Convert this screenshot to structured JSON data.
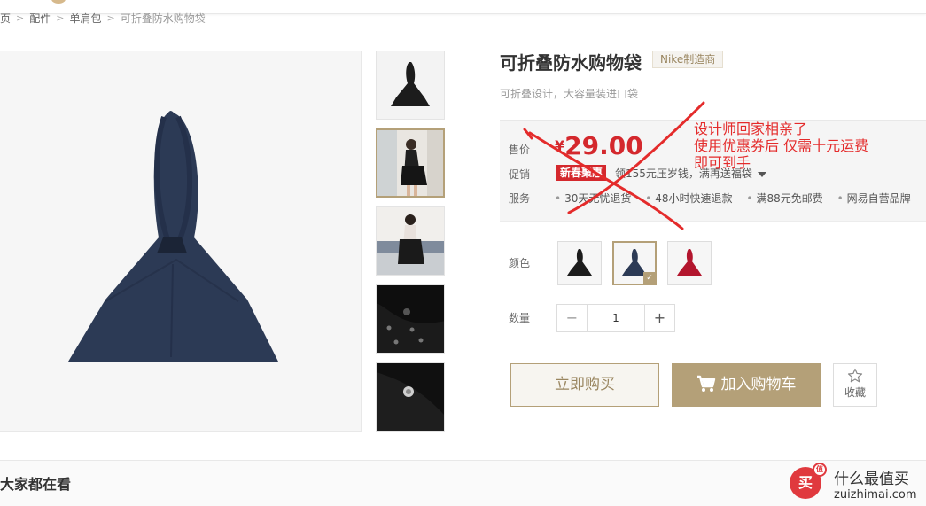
{
  "breadcrumb": {
    "first": "页",
    "second": "配件",
    "third": "单肩包",
    "current": "可折叠防水购物袋",
    "separator": ">"
  },
  "product": {
    "title": "可折叠防水购物袋",
    "maker_tag": "Nike制造商",
    "subtitle": "可折叠设计，大容量装进口袋"
  },
  "price_box": {
    "price_label": "售价",
    "currency": "¥",
    "price": "29.00",
    "promo_label": "促销",
    "promo_tag": "新春聚惠",
    "promo_text": "领155元压岁钱，满再送福袋",
    "service_label": "服务",
    "services": [
      "30天无忧退货",
      "48小时快速退款",
      "满88元免邮费",
      "网易自营品牌"
    ]
  },
  "spec": {
    "color_label": "颜色",
    "colors": [
      "black",
      "navy",
      "red"
    ],
    "color_hex": {
      "black": "#1c1c1c",
      "navy": "#2c3a55",
      "red": "#b3162e"
    },
    "selected_color": "navy",
    "qty_label": "数量",
    "qty_value": "1",
    "minus": "−",
    "plus": "+"
  },
  "actions": {
    "buy_now": "立即购买",
    "add_to_cart": "加入购物车",
    "favorite": "收藏"
  },
  "footer": {
    "section_title": "大家都在看"
  },
  "annotation": {
    "lines": [
      "设计师回家相亲了",
      "使用优惠券后  仅需十元运费",
      "即可到手"
    ],
    "color": "#e42b2b"
  },
  "watermark": {
    "badge": "买",
    "badge_sup": "值",
    "name_cn": "什么最值买",
    "name_en": "zuizhimai.com"
  },
  "colors": {
    "accent": "#b4a078",
    "price_red": "#d4282d",
    "border": "#e8e8e8"
  }
}
